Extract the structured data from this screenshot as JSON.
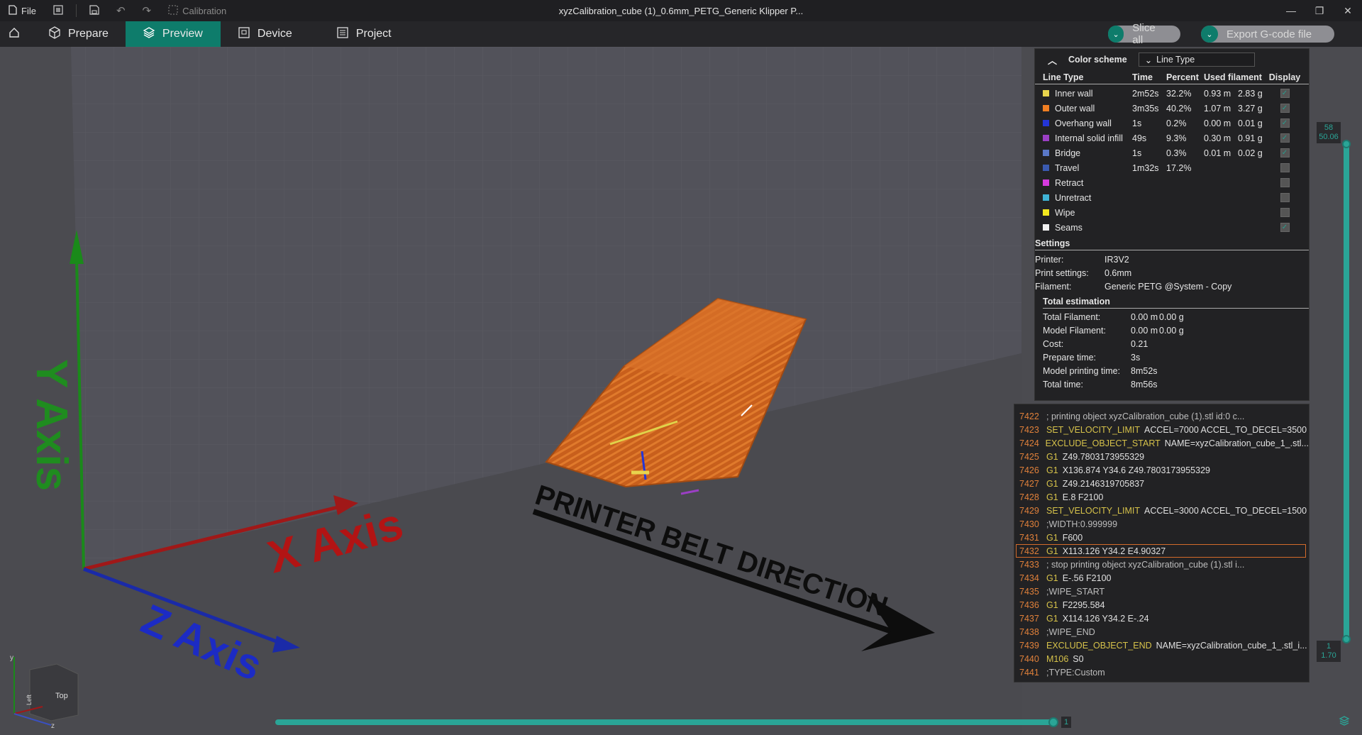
{
  "titlebar": {
    "file_label": "File",
    "calibration_label": "Calibration",
    "window_title": "xyzCalibration_cube (1)_0.6mm_PETG_Generic Klipper P...",
    "minimize": "—",
    "maximize": "❐",
    "close": "✕"
  },
  "tabs": [
    {
      "label": "Prepare",
      "icon": "cube-icon"
    },
    {
      "label": "Preview",
      "icon": "layers-icon",
      "active": true
    },
    {
      "label": "Device",
      "icon": "device-icon"
    },
    {
      "label": "Project",
      "icon": "project-icon"
    }
  ],
  "actions": {
    "slice_all": "Slice all",
    "export_gcode": "Export G-code file"
  },
  "scene": {
    "y_axis": "Y Axis",
    "x_axis": "X Axis",
    "z_axis": "Z Axis",
    "belt": "PRINTER BELT DIRECTION",
    "cube_top": "Top",
    "cube_left": "Left",
    "mini_y": "y",
    "mini_z": "z"
  },
  "legend": {
    "color_scheme_label": "Color scheme",
    "color_scheme_value": "Line Type",
    "columns": {
      "type": "Line Type",
      "time": "Time",
      "percent": "Percent",
      "used": "Used filament",
      "display": "Display"
    },
    "rows": [
      {
        "name": "Inner wall",
        "color": "#e8d44d",
        "time": "2m52s",
        "percent": "32.2%",
        "length": "0.93 m",
        "weight": "2.83 g",
        "display": true
      },
      {
        "name": "Outer wall",
        "color": "#f07e22",
        "time": "3m35s",
        "percent": "40.2%",
        "length": "1.07 m",
        "weight": "3.27 g",
        "display": true
      },
      {
        "name": "Overhang wall",
        "color": "#2435d6",
        "time": "1s",
        "percent": "0.2%",
        "length": "0.00 m",
        "weight": "0.01 g",
        "display": true
      },
      {
        "name": "Internal solid infill",
        "color": "#9b3fc4",
        "time": "49s",
        "percent": "9.3%",
        "length": "0.30 m",
        "weight": "0.91 g",
        "display": true
      },
      {
        "name": "Bridge",
        "color": "#5a78c8",
        "time": "1s",
        "percent": "0.3%",
        "length": "0.01 m",
        "weight": "0.02 g",
        "display": true
      },
      {
        "name": "Travel",
        "color": "#3a5ab0",
        "time": "1m32s",
        "percent": "17.2%",
        "length": "",
        "weight": "",
        "display": false
      },
      {
        "name": "Retract",
        "color": "#d63adf",
        "time": "",
        "percent": "",
        "length": "",
        "weight": "",
        "display": false
      },
      {
        "name": "Unretract",
        "color": "#3fb3d6",
        "time": "",
        "percent": "",
        "length": "",
        "weight": "",
        "display": false
      },
      {
        "name": "Wipe",
        "color": "#f3e81f",
        "time": "",
        "percent": "",
        "length": "",
        "weight": "",
        "display": false
      },
      {
        "name": "Seams",
        "color": "#f2f2f2",
        "time": "",
        "percent": "",
        "length": "",
        "weight": "",
        "display": true
      }
    ],
    "settings_title": "Settings",
    "settings": [
      {
        "key": "Printer:",
        "value": "IR3V2"
      },
      {
        "key": "Print settings:",
        "value": "0.6mm"
      },
      {
        "key": "Filament:",
        "value": "Generic PETG @System - Copy"
      }
    ],
    "estimation_title": "Total estimation",
    "estimation": [
      {
        "key": "Total Filament:",
        "v1": "0.00 m",
        "v2": "0.00 g"
      },
      {
        "key": "Model Filament:",
        "v1": "0.00 m",
        "v2": "0.00 g"
      },
      {
        "key": "Cost:",
        "v1": "0.21",
        "v2": ""
      },
      {
        "key": "Prepare time:",
        "v1": "3s",
        "v2": ""
      },
      {
        "key": "Model printing time:",
        "v1": "8m52s",
        "v2": ""
      },
      {
        "key": "Total time:",
        "v1": "8m56s",
        "v2": ""
      }
    ]
  },
  "gcode": [
    {
      "n": "7422",
      "cmd": "",
      "rest": "; printing object xyzCalibration_cube (1).stl id:0 c..."
    },
    {
      "n": "7423",
      "cmd": "SET_VELOCITY_LIMIT",
      "rest": "ACCEL=7000 ACCEL_TO_DECEL=3500"
    },
    {
      "n": "7424",
      "cmd": "EXCLUDE_OBJECT_START",
      "rest": "NAME=xyzCalibration_cube_1_.stl..."
    },
    {
      "n": "7425",
      "cmd": "G1",
      "rest": "Z49.7803173955329"
    },
    {
      "n": "7426",
      "cmd": "G1",
      "rest": "X136.874 Y34.6 Z49.7803173955329"
    },
    {
      "n": "7427",
      "cmd": "G1",
      "rest": "Z49.2146319705837"
    },
    {
      "n": "7428",
      "cmd": "G1",
      "rest": "E.8 F2100"
    },
    {
      "n": "7429",
      "cmd": "SET_VELOCITY_LIMIT",
      "rest": "ACCEL=3000 ACCEL_TO_DECEL=1500"
    },
    {
      "n": "7430",
      "cmd": "",
      "rest": ";WIDTH:0.999999"
    },
    {
      "n": "7431",
      "cmd": "G1",
      "rest": "F600"
    },
    {
      "n": "7432",
      "cmd": "G1",
      "rest": "X113.126 Y34.2 E4.90327",
      "selected": true
    },
    {
      "n": "7433",
      "cmd": "",
      "rest": "; stop printing object xyzCalibration_cube (1).stl i..."
    },
    {
      "n": "7434",
      "cmd": "G1",
      "rest": "E-.56 F2100"
    },
    {
      "n": "7435",
      "cmd": "",
      "rest": ";WIPE_START"
    },
    {
      "n": "7436",
      "cmd": "G1",
      "rest": "F2295.584"
    },
    {
      "n": "7437",
      "cmd": "G1",
      "rest": "X114.126 Y34.2 E-.24"
    },
    {
      "n": "7438",
      "cmd": "",
      "rest": ";WIPE_END"
    },
    {
      "n": "7439",
      "cmd": "EXCLUDE_OBJECT_END",
      "rest": "NAME=xyzCalibration_cube_1_.stl_i..."
    },
    {
      "n": "7440",
      "cmd": "M106",
      "rest": "S0"
    },
    {
      "n": "7441",
      "cmd": "",
      "rest": ";TYPE:Custom"
    }
  ],
  "sliders": {
    "top_layer": "58",
    "top_height": "50.06",
    "bottom_layer": "1",
    "bottom_height": "1.70",
    "horizontal_value": "1"
  }
}
